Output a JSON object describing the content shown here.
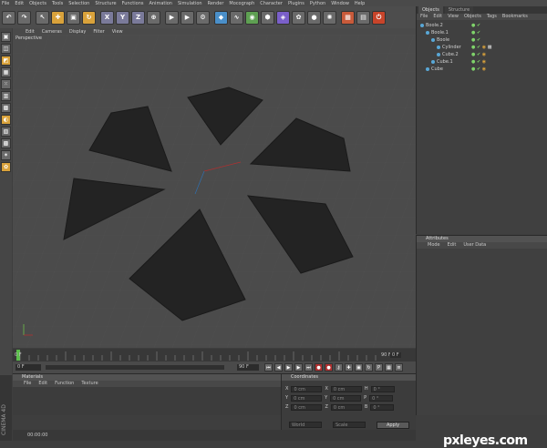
{
  "menubar": [
    "File",
    "Edit",
    "Objects",
    "Tools",
    "Selection",
    "Structure",
    "Functions",
    "Animation",
    "Simulation",
    "Render",
    "Mocograph",
    "Character",
    "Plugins",
    "Python",
    "Window",
    "Help"
  ],
  "viewport_menu": [
    "Edit",
    "Cameras",
    "Display",
    "Filter",
    "View"
  ],
  "viewport_label": "Perspective",
  "toolbar_axis": [
    "X",
    "Y",
    "Z"
  ],
  "right_tabs": [
    "Objects",
    "Structure"
  ],
  "right_menu": [
    "File",
    "Edit",
    "View",
    "Objects",
    "Tags",
    "Bookmarks"
  ],
  "tree": [
    {
      "name": "Boole.2",
      "indent": 0
    },
    {
      "name": "Boole.1",
      "indent": 1
    },
    {
      "name": "Boole",
      "indent": 2
    },
    {
      "name": "Cylinder",
      "indent": 3
    },
    {
      "name": "Cube.2",
      "indent": 3
    },
    {
      "name": "Cube.1",
      "indent": 2
    },
    {
      "name": "Cube",
      "indent": 1
    }
  ],
  "attr_title": "Attributes",
  "attr_menu": [
    "Mode",
    "Edit",
    "User Data"
  ],
  "timeline": {
    "start": "0 F",
    "end": "90 F",
    "current": "0 F",
    "frame_field": "0 F",
    "end_field": "90 F"
  },
  "materials_title": "Materials",
  "materials_menu": [
    "File",
    "Edit",
    "Function",
    "Texture"
  ],
  "coord_title": "Coordinates",
  "coord_rows": [
    {
      "a": "X",
      "av": "0 cm",
      "b": "X",
      "bv": "0 cm",
      "c": "H",
      "cv": "0 °"
    },
    {
      "a": "Y",
      "av": "0 cm",
      "b": "Y",
      "bv": "0 cm",
      "c": "P",
      "cv": "0 °"
    },
    {
      "a": "Z",
      "av": "0 cm",
      "b": "Z",
      "bv": "0 cm",
      "c": "B",
      "cv": "0 °"
    }
  ],
  "coord_dropdowns": [
    "World",
    "Scale"
  ],
  "apply_label": "Apply",
  "status_time": "00:00:00",
  "brand_vertical": "CINEMA 4D",
  "watermark": {
    "text": "pxleyes.com"
  },
  "colors": {
    "bg": "#4b4b4b",
    "shape": "#222222",
    "accent": "#59a7d6"
  }
}
